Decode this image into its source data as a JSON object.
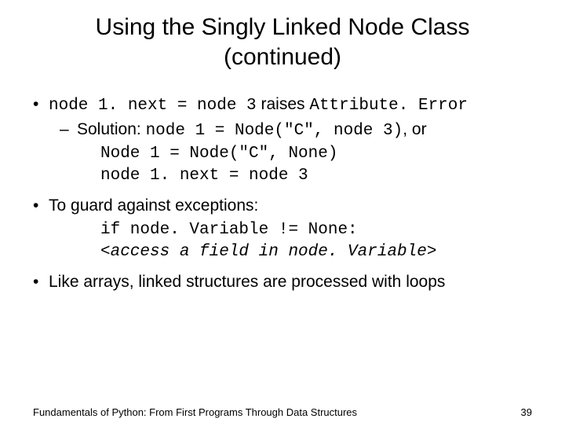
{
  "title_l1": "Using the Singly Linked Node Class",
  "title_l2": "(continued)",
  "bul1": {
    "code_a": "node 1. next = node 3",
    "word_raises": " raises ",
    "code_b": "Attribute. Error"
  },
  "sub1": {
    "label": "Solution: ",
    "code_a": "node 1 = Node(\"C\", node 3)",
    "word_or": ", or"
  },
  "code_line2": "Node 1 = Node(\"C\", None)",
  "code_line3": "node 1. next = node 3",
  "bul2": "To guard against exceptions:",
  "guard_line1": "if node. Variable != None:",
  "guard_line2": "<access a field in node. Variable>",
  "bul3": "Like arrays, linked structures are processed with loops",
  "footer": "Fundamentals of Python: From First Programs Through Data Structures",
  "page": "39"
}
